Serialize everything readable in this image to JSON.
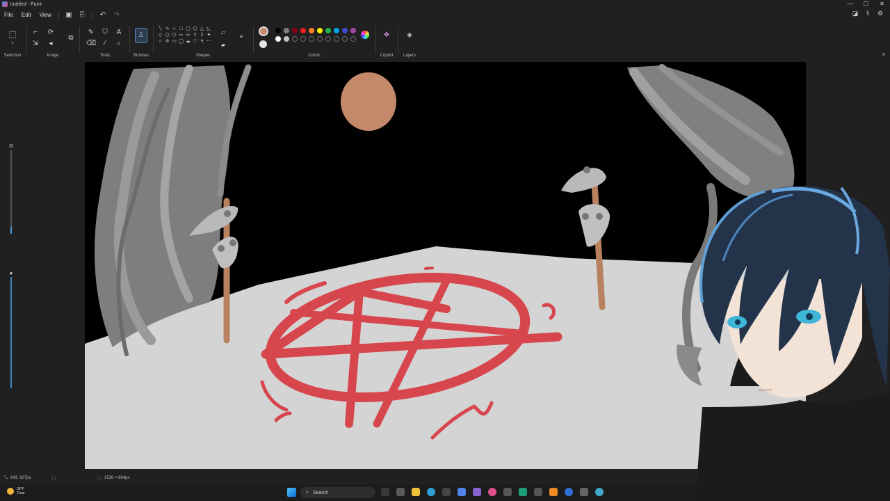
{
  "window": {
    "title": "Untitled - Paint",
    "controls": [
      "—",
      "☐",
      "✕"
    ]
  },
  "menu": {
    "file": "File",
    "edit": "Edit",
    "view": "View"
  },
  "ribbon": {
    "groups": {
      "selection": "Selection",
      "image": "Image",
      "tools": "Tools",
      "brushes": "Brushes",
      "shapes": "Shapes",
      "colors": "Colors",
      "copilot": "Copilot",
      "layers": "Layers"
    },
    "palette_row1": [
      "#000000",
      "#7f7f7f",
      "#880015",
      "#ed1c24",
      "#ff7f27",
      "#fff200",
      "#22b14c",
      "#00a2e8",
      "#3f48cc",
      "#a349a4"
    ],
    "palette_row2": [
      "#ffffff",
      "#c3c3c3",
      "#b97a57",
      "#ffaec9",
      "#ffc90e",
      "#efe4b0",
      "#b5e61d",
      "#99d9ea",
      "#7092be",
      "#c8bfe7"
    ],
    "color1": "#c58a6a",
    "color2": "#e6e6e6"
  },
  "status": {
    "cursor_position": "643, 107px",
    "canvas_size": "1536 × 864px"
  },
  "taskbar": {
    "weather_temp": "38°F",
    "weather_desc": "Clear",
    "search_placeholder": "Search"
  },
  "colors": {
    "drawing_background": "#000000",
    "ground": "#d4d4d4",
    "pentagram": "#d8333a",
    "moon": "#c4896a",
    "rocks": "#8a8a8a"
  }
}
